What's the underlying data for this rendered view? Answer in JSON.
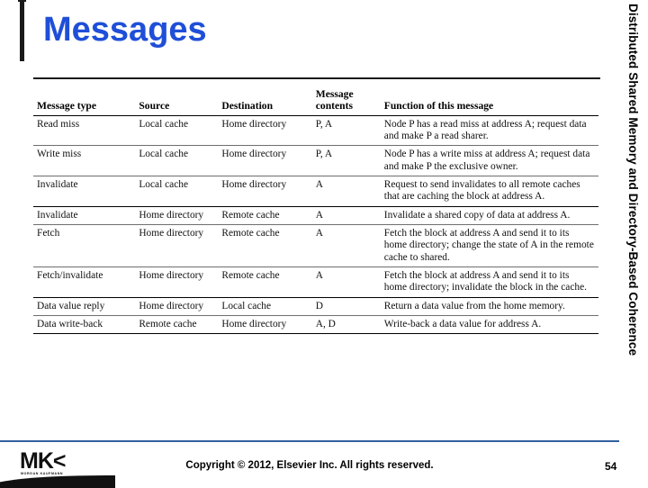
{
  "slide": {
    "title": "Messages",
    "side_label": "Distributed Shared Memory and Directory-Based Coherence",
    "accent_color": "#1f4fd8",
    "footer_rule_color": "#2f5f9e"
  },
  "table": {
    "headers": [
      "Message type",
      "Source",
      "Destination",
      "Message\ncontents",
      "Function of this message"
    ],
    "rows": [
      {
        "type": "Read miss",
        "source": "Local cache",
        "destination": "Home directory",
        "contents": "P, A",
        "function": "Node P has a read miss at address A; request data and make P a read sharer."
      },
      {
        "type": "Write miss",
        "source": "Local cache",
        "destination": "Home directory",
        "contents": "P, A",
        "function": "Node P has a write miss at address A; request data and make P the exclusive owner."
      },
      {
        "type": "Invalidate",
        "source": "Local cache",
        "destination": "Home directory",
        "contents": "A",
        "function": "Request to send invalidates to all remote caches that are caching the block at address A."
      },
      {
        "type": "Invalidate",
        "source": "Home directory",
        "destination": "Remote cache",
        "contents": "A",
        "function": "Invalidate a shared copy of data at address A."
      },
      {
        "type": "Fetch",
        "source": "Home directory",
        "destination": "Remote cache",
        "contents": "A",
        "function": "Fetch the block at address A and send it to its home directory; change the state of A in the remote cache to shared."
      },
      {
        "type": "Fetch/invalidate",
        "source": "Home directory",
        "destination": "Remote cache",
        "contents": "A",
        "function": "Fetch the block at address A and send it to its home directory; invalidate the block in the cache."
      },
      {
        "type": "Data value reply",
        "source": "Home directory",
        "destination": "Local cache",
        "contents": "D",
        "function": "Return a data value from the home memory."
      },
      {
        "type": "Data write-back",
        "source": "Remote cache",
        "destination": "Home directory",
        "contents": "A, D",
        "function": "Write-back a data value for address A."
      }
    ]
  },
  "footer": {
    "copyright": "Copyright © 2012, Elsevier Inc. All rights reserved.",
    "page_number": "54",
    "logo_mark": "MK<",
    "logo_sub": "MORGAN KAUFMANN"
  }
}
